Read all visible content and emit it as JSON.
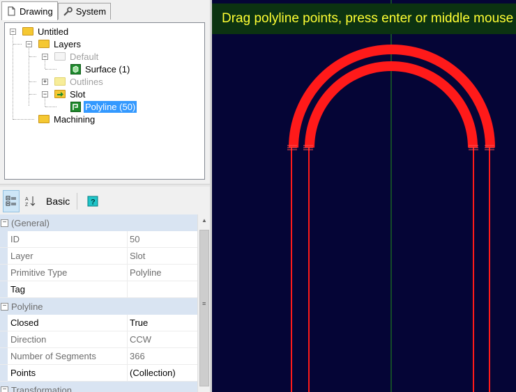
{
  "tabs": [
    {
      "label": "Drawing",
      "icon": "document-icon",
      "active": true
    },
    {
      "label": "System",
      "icon": "wrench-icon",
      "active": false
    }
  ],
  "tree": {
    "root": "Untitled",
    "layers": "Layers",
    "default": "Default",
    "surface": "Surface (1)",
    "outlines": "Outlines",
    "slot": "Slot",
    "polyline": "Polyline (50)",
    "machining": "Machining"
  },
  "toolbar": {
    "categorized_icon": "categorized-icon",
    "alphabetical_icon": "sort-az-icon",
    "basic_label": "Basic",
    "help_icon": "help-icon"
  },
  "properties": {
    "general": {
      "title": "(General)",
      "rows": [
        {
          "key": "ID",
          "value": "50"
        },
        {
          "key": "Layer",
          "value": "Slot"
        },
        {
          "key": "Primitive Type",
          "value": "Polyline"
        },
        {
          "key": "Tag",
          "value": ""
        }
      ]
    },
    "polyline": {
      "title": "Polyline",
      "rows": [
        {
          "key": "Closed",
          "value": "True"
        },
        {
          "key": "Direction",
          "value": "CCW"
        },
        {
          "key": "Number of Segments",
          "value": "366"
        },
        {
          "key": "Points",
          "value": "(Collection)"
        }
      ]
    },
    "transformation": {
      "title": "Transformation"
    }
  },
  "viewport": {
    "banner": "Drag polyline points, press enter or middle mouse",
    "background": "#050536",
    "shape_color": "#ff1a1a",
    "axis_color": "#1f7a1f",
    "banner_bg": "#0c3311",
    "banner_fg": "#ffff33"
  }
}
